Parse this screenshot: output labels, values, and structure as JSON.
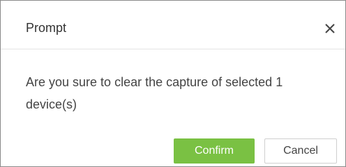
{
  "dialog": {
    "title": "Prompt",
    "close_icon": "close-icon",
    "message": "Are you sure to clear the capture of selected 1 device(s)",
    "confirm_label": "Confirm",
    "cancel_label": "Cancel"
  },
  "colors": {
    "confirm_bg": "#7ac143",
    "confirm_text": "#ffffff",
    "text": "#444444",
    "border": "#8a8a8a"
  }
}
